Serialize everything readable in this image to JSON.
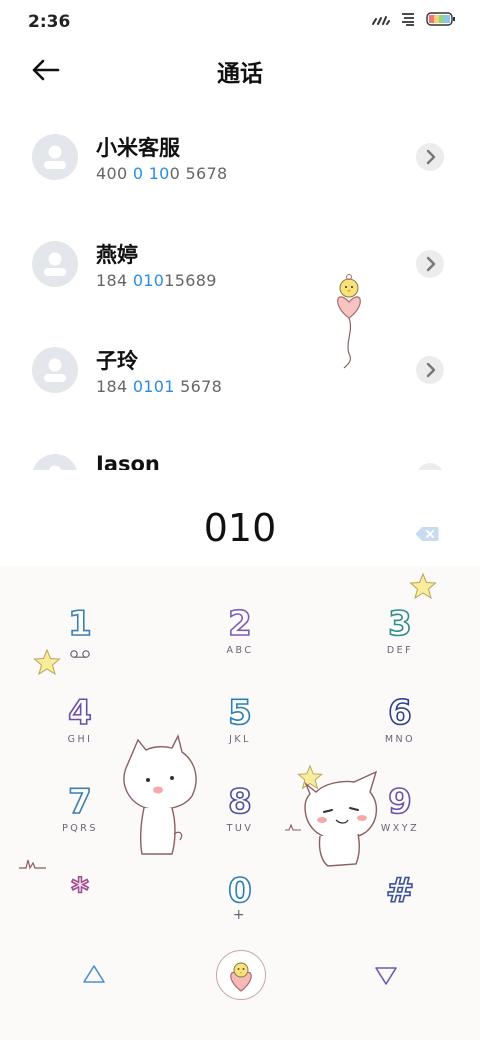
{
  "status_bar": {
    "time": "2:36"
  },
  "header": {
    "title": "通话"
  },
  "contacts": [
    {
      "name": "小米客服",
      "number_parts": [
        {
          "t": "400 ",
          "h": false
        },
        {
          "t": "0",
          "h": true
        },
        {
          "t": " ",
          "h": false
        },
        {
          "t": "10",
          "h": true
        },
        {
          "t": "0 5678",
          "h": false
        }
      ]
    },
    {
      "name": "燕婷",
      "number_parts": [
        {
          "t": "184 ",
          "h": false
        },
        {
          "t": "010",
          "h": true
        },
        {
          "t": "15689",
          "h": false
        }
      ]
    },
    {
      "name": "子玲",
      "number_parts": [
        {
          "t": "184 ",
          "h": false
        },
        {
          "t": "0101",
          "h": true
        },
        {
          "t": " 5678",
          "h": false
        }
      ]
    },
    {
      "name": "Jason",
      "number_parts": []
    }
  ],
  "dialer": {
    "number": "010"
  },
  "keypad": [
    {
      "digit": "1",
      "letters": ""
    },
    {
      "digit": "2",
      "letters": "ABC"
    },
    {
      "digit": "3",
      "letters": "DEF"
    },
    {
      "digit": "4",
      "letters": "GHI"
    },
    {
      "digit": "5",
      "letters": "JKL"
    },
    {
      "digit": "6",
      "letters": "MNO"
    },
    {
      "digit": "7",
      "letters": "PQRS"
    },
    {
      "digit": "8",
      "letters": "TUV"
    },
    {
      "digit": "9",
      "letters": "WXYZ"
    },
    {
      "digit": "*",
      "letters": ""
    },
    {
      "digit": "0",
      "letters": "+"
    },
    {
      "digit": "#",
      "letters": ""
    }
  ],
  "colors": {
    "highlight": "#2a8de4",
    "avatar_bg": "#e3e6ea"
  },
  "icons": [
    "back-arrow-icon",
    "signal-icon",
    "wifi-icon",
    "battery-icon",
    "chevron-right-icon",
    "backspace-icon",
    "voicemail-icon",
    "triangle-up-icon",
    "triangle-down-icon",
    "call-icon"
  ]
}
